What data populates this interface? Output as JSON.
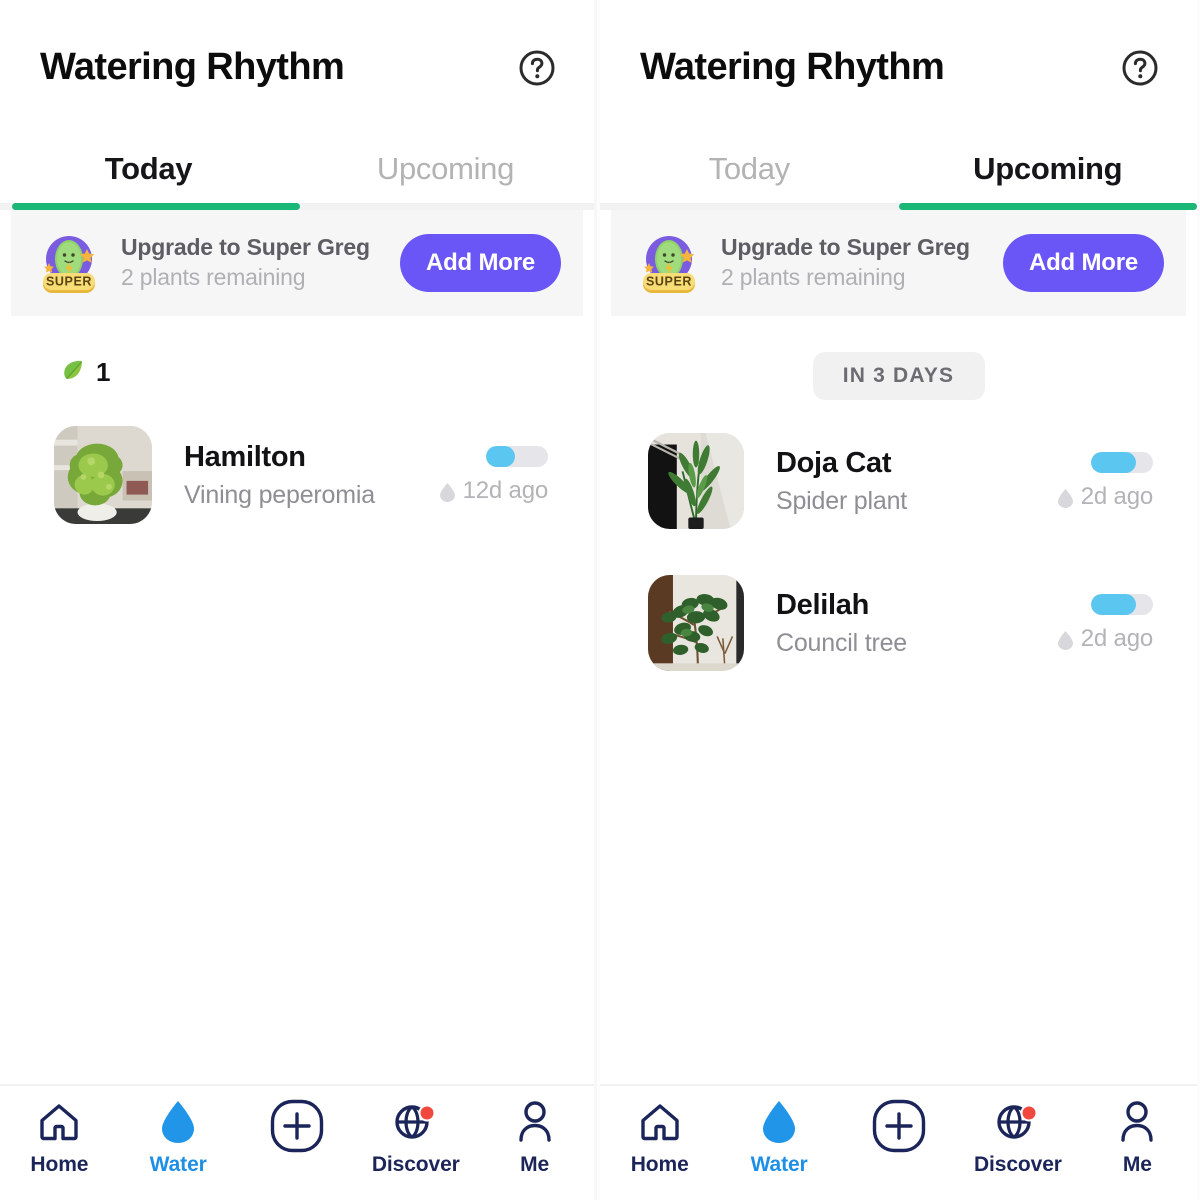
{
  "app": {
    "title": "Watering Rhythm",
    "help_icon": "help-circle-icon",
    "accent_green": "#1bb776",
    "accent_blue": "#1e8fe4",
    "accent_purple": "#6a56f6",
    "water_fill": "#5bc6f0"
  },
  "promo": {
    "badge_icon": "super-greg-badge-icon",
    "badge_ribbon": "SUPER",
    "title": "Upgrade to Super Greg",
    "subtitle": "2 plants remaining",
    "cta_label": "Add More"
  },
  "tabs": [
    {
      "label": "Today"
    },
    {
      "label": "Upcoming"
    }
  ],
  "panels": [
    {
      "id": "today-panel",
      "active_tab": 0,
      "leaf": {
        "icon": "leaf-icon",
        "count": "1"
      },
      "plants": [
        {
          "name": "Hamilton",
          "species": "Vining peperomia",
          "last_watered": "12d ago",
          "water_icon": "water-drop-icon",
          "level_percent": 46,
          "thumb": "vining-peperomia-photo"
        }
      ]
    },
    {
      "id": "upcoming-panel",
      "active_tab": 1,
      "section_badge": "IN 3 DAYS",
      "plants": [
        {
          "name": "Doja Cat",
          "species": "Spider plant",
          "last_watered": "2d ago",
          "water_icon": "water-drop-icon",
          "level_percent": 72,
          "thumb": "spider-plant-photo"
        },
        {
          "name": "Delilah",
          "species": "Council tree",
          "last_watered": "2d ago",
          "water_icon": "water-drop-icon",
          "level_percent": 72,
          "thumb": "council-tree-photo"
        }
      ]
    }
  ],
  "nav": [
    {
      "label": "Home",
      "icon": "home-icon",
      "active": false,
      "badge": false
    },
    {
      "label": "Water",
      "icon": "water-drop-icon",
      "active": true,
      "badge": false
    },
    {
      "label": "",
      "icon": "plus-icon",
      "active": false,
      "badge": false
    },
    {
      "label": "Discover",
      "icon": "globe-icon",
      "active": false,
      "badge": true
    },
    {
      "label": "Me",
      "icon": "person-icon",
      "active": false,
      "badge": false
    }
  ]
}
